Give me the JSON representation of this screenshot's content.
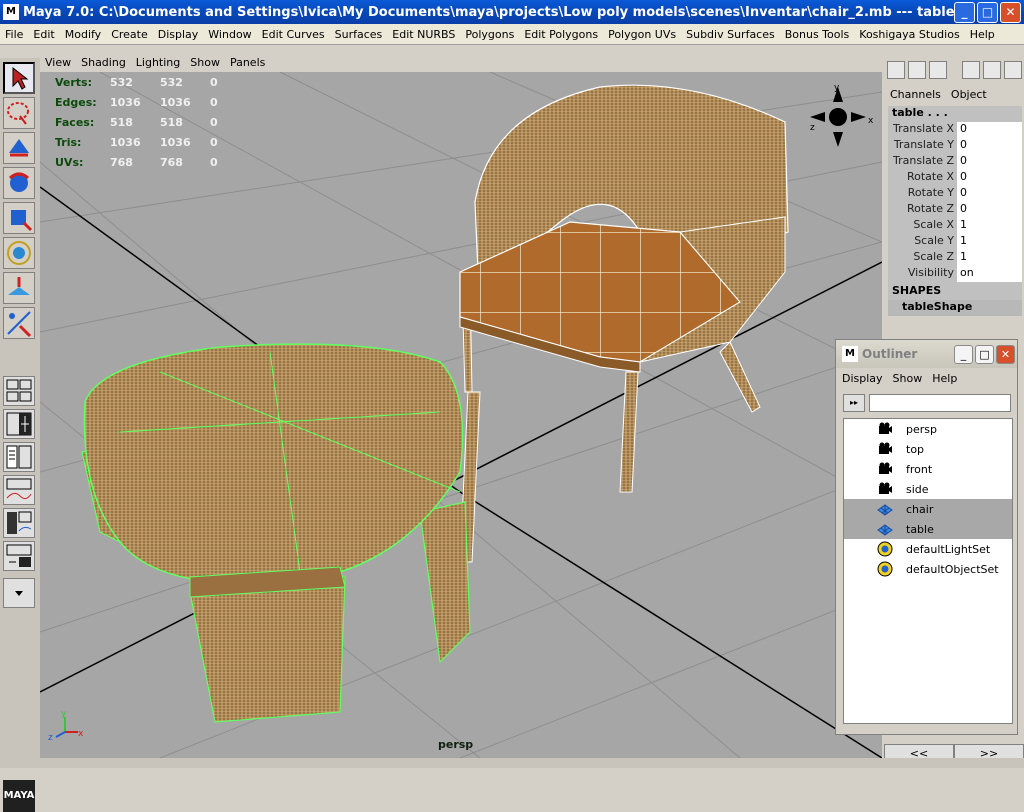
{
  "window": {
    "title": "Maya 7.0: C:\\Documents and Settings\\Ivica\\My Documents\\maya\\projects\\Low poly models\\scenes\\Inventar\\chair_2.mb   ---   table...",
    "icon_name": "maya-app-icon",
    "min_label": "_",
    "max_label": "□",
    "close_label": "✕"
  },
  "menubar": [
    "File",
    "Edit",
    "Modify",
    "Create",
    "Display",
    "Window",
    "Edit Curves",
    "Surfaces",
    "Edit NURBS",
    "Polygons",
    "Edit Polygons",
    "Polygon UVs",
    "Subdiv Surfaces",
    "Bonus Tools",
    "Koshigaya Studios",
    "Help"
  ],
  "panel_menu": [
    "View",
    "Shading",
    "Lighting",
    "Show",
    "Panels"
  ],
  "hud": {
    "rows": [
      {
        "label": "Verts:",
        "a": "532",
        "b": "532",
        "c": "0"
      },
      {
        "label": "Edges:",
        "a": "1036",
        "b": "1036",
        "c": "0"
      },
      {
        "label": "Faces:",
        "a": "518",
        "b": "518",
        "c": "0"
      },
      {
        "label": "Tris:",
        "a": "1036",
        "b": "1036",
        "c": "0"
      },
      {
        "label": "UVs:",
        "a": "768",
        "b": "768",
        "c": "0"
      }
    ]
  },
  "viewport": {
    "camera_label": "persp",
    "axis": {
      "y": "y",
      "x": "x",
      "z": "z"
    }
  },
  "channelbox": {
    "tabs": [
      "Channels",
      "Object"
    ],
    "object_name": "table . . .",
    "attributes": [
      {
        "name": "Translate X",
        "value": "0"
      },
      {
        "name": "Translate Y",
        "value": "0"
      },
      {
        "name": "Translate Z",
        "value": "0"
      },
      {
        "name": "Rotate X",
        "value": "0"
      },
      {
        "name": "Rotate Y",
        "value": "0"
      },
      {
        "name": "Rotate Z",
        "value": "0"
      },
      {
        "name": "Scale X",
        "value": "1"
      },
      {
        "name": "Scale Y",
        "value": "1"
      },
      {
        "name": "Scale Z",
        "value": "1"
      },
      {
        "name": "Visibility",
        "value": "on"
      }
    ],
    "shapes_header": "SHAPES",
    "shape_item": "tableShape",
    "nav": [
      "<<",
      ">>"
    ]
  },
  "outliner": {
    "title": "Outliner",
    "menu": [
      "Display",
      "Show",
      "Help"
    ],
    "filter_value": "",
    "items": [
      {
        "label": "persp",
        "icon": "camera-icon",
        "selected": false
      },
      {
        "label": "top",
        "icon": "camera-icon",
        "selected": false
      },
      {
        "label": "front",
        "icon": "camera-icon",
        "selected": false
      },
      {
        "label": "side",
        "icon": "camera-icon",
        "selected": false
      },
      {
        "label": "chair",
        "icon": "mesh-icon",
        "selected": true
      },
      {
        "label": "table",
        "icon": "mesh-icon",
        "selected": true
      },
      {
        "label": "defaultLightSet",
        "icon": "set-icon",
        "selected": false
      },
      {
        "label": "defaultObjectSet",
        "icon": "set-icon",
        "selected": false
      }
    ]
  },
  "colors": {
    "viewport_bg": "#a6a6a6",
    "wicker": "#b8905a",
    "seat": "#b06a2c",
    "table_wire": "#70ff70",
    "chair_wire": "#ffffff"
  }
}
